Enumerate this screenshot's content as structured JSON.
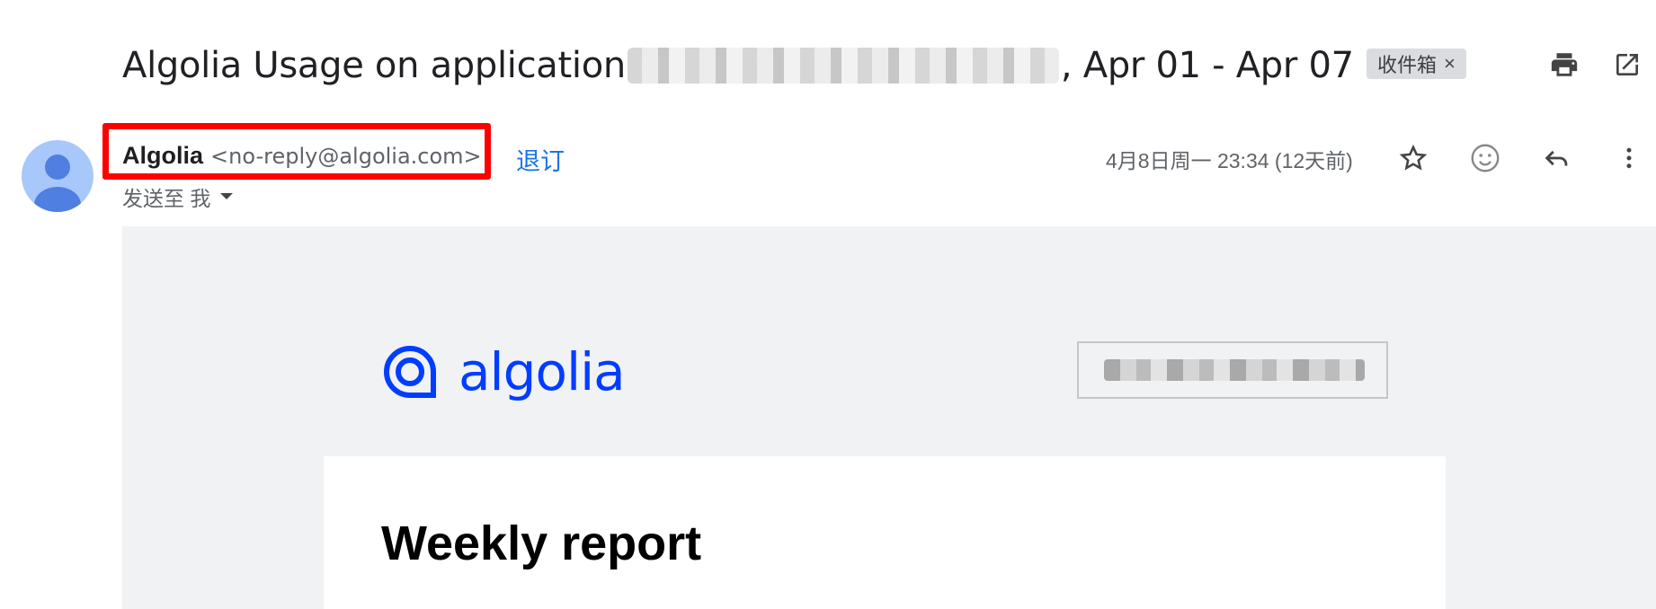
{
  "email": {
    "subject_prefix": "Algolia Usage on application",
    "subject_suffix": ", Apr 01 - Apr 07",
    "label_chip": "收件箱",
    "label_chip_close": "×",
    "sender_name": "Algolia",
    "sender_email": "<no-reply@algolia.com>",
    "unsubscribe": "退订",
    "sent_to": "发送至 我",
    "timestamp": "4月8日周一 23:34 (12天前)"
  },
  "icons": {
    "print": "print-icon",
    "open_new": "open-in-new-window-icon",
    "star": "star-icon",
    "emoji": "emoji-reaction-icon",
    "reply": "reply-icon",
    "more": "more-vertical-icon",
    "dropdown": "caret-down-icon"
  },
  "body": {
    "logo_text": "algolia",
    "report_title": "Weekly report"
  },
  "colors": {
    "brand": "#003dff",
    "link": "#1a73e8",
    "highlight": "#ff0000"
  }
}
